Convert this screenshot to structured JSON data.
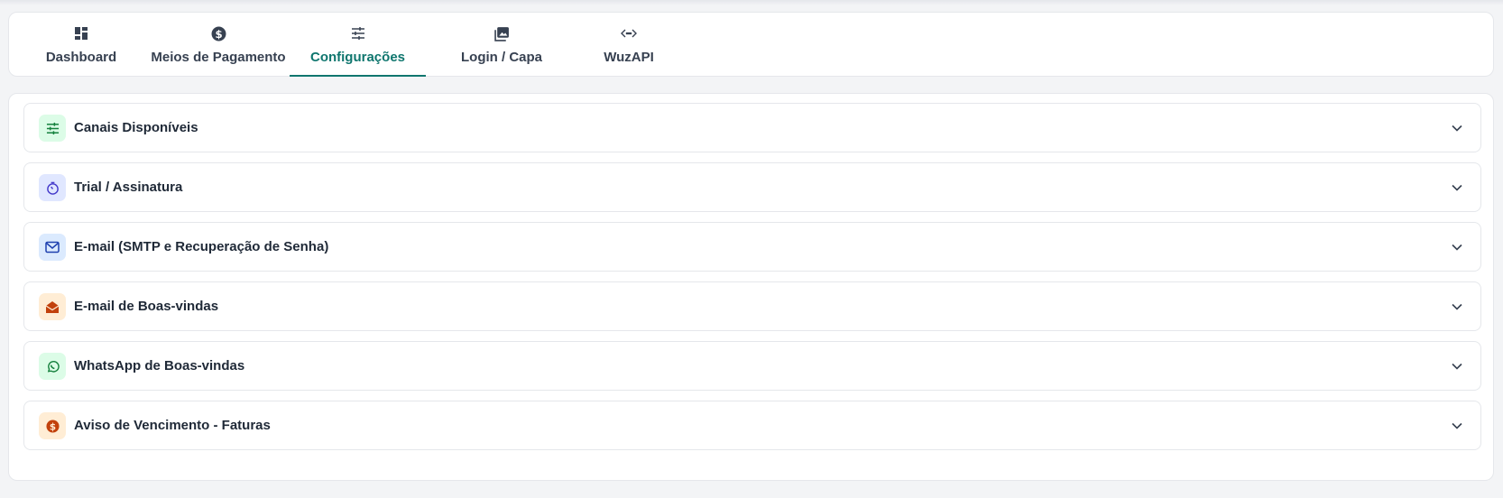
{
  "tabs": [
    {
      "label": "Dashboard",
      "icon": "dashboard-icon",
      "active": false
    },
    {
      "label": "Meios de Pagamento",
      "icon": "dollar-circle-icon",
      "active": false
    },
    {
      "label": "Configurações",
      "icon": "sliders-icon",
      "active": true
    },
    {
      "label": "Login / Capa",
      "icon": "image-icon",
      "active": false
    },
    {
      "label": "WuzAPI",
      "icon": "code-icon",
      "active": false
    }
  ],
  "sections": [
    {
      "label": "Canais Disponíveis",
      "icon": "sliders-icon",
      "icon_bg": "#dcfce7",
      "icon_color": "#15803d"
    },
    {
      "label": "Trial / Assinatura",
      "icon": "timer-icon",
      "icon_bg": "#e0e7ff",
      "icon_color": "#4338ca"
    },
    {
      "label": "E-mail (SMTP e Recuperação de Senha)",
      "icon": "mail-icon",
      "icon_bg": "#dbeafe",
      "icon_color": "#1e40af"
    },
    {
      "label": "E-mail de Boas-vindas",
      "icon": "mail-open-icon",
      "icon_bg": "#ffedd5",
      "icon_color": "#c2410c"
    },
    {
      "label": "WhatsApp de Boas-vindas",
      "icon": "whatsapp-icon",
      "icon_bg": "#dcfce7",
      "icon_color": "#15803d"
    },
    {
      "label": "Aviso de Vencimento - Faturas",
      "icon": "dollar-circle-icon",
      "icon_bg": "#ffedd5",
      "icon_color": "#c2410c"
    }
  ],
  "colors": {
    "accent": "#0f766e",
    "tab_text": "#374151",
    "border": "#e5e7eb",
    "background": "#f3f4f6"
  }
}
